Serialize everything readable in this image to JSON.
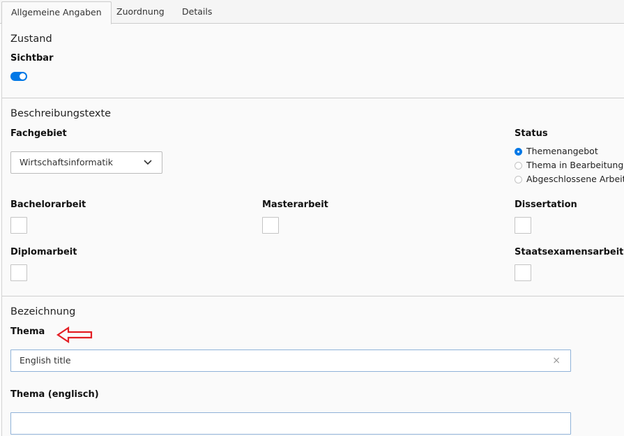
{
  "tabs": [
    {
      "label": "Allgemeine Angaben",
      "active": true
    },
    {
      "label": "Zuordnung",
      "active": false
    },
    {
      "label": "Details",
      "active": false
    }
  ],
  "zustand": {
    "title": "Zustand",
    "sichtbar_label": "Sichtbar",
    "sichtbar_on": true
  },
  "beschreibung": {
    "title": "Beschreibungstexte",
    "fachgebiet_label": "Fachgebiet",
    "fachgebiet_value": "Wirtschaftsinformatik",
    "status_label": "Status",
    "status_options": [
      {
        "label": "Themenangebot",
        "selected": true
      },
      {
        "label": "Thema in Bearbeitung",
        "selected": false
      },
      {
        "label": "Abgeschlossene Arbeit",
        "selected": false
      }
    ],
    "checkboxes": {
      "bachelor": "Bachelorarbeit",
      "master": "Masterarbeit",
      "dissertation": "Dissertation",
      "diplom": "Diplomarbeit",
      "staatsexamen": "Staatsexamensarbeit"
    }
  },
  "bezeichnung": {
    "title": "Bezeichnung",
    "thema_label": "Thema",
    "thema_value": "English title",
    "thema_clear": "×",
    "thema_en_label": "Thema (englisch)",
    "thema_en_value": ""
  },
  "colors": {
    "accent": "#0078e6",
    "annotation_arrow": "#e31e24"
  }
}
